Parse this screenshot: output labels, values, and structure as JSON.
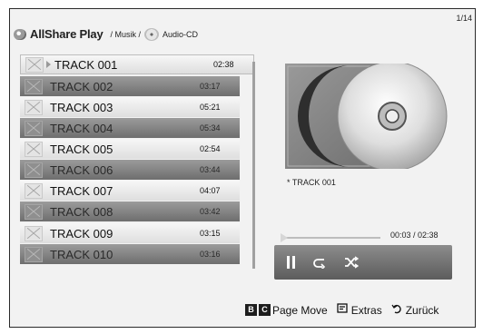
{
  "header": {
    "app_name": "AllShare Play",
    "crumb_music": "/ Musik /",
    "crumb_source": "Audio-CD",
    "page_indicator": "1/14"
  },
  "tracks": [
    {
      "name": "TRACK 001",
      "duration": "02:38"
    },
    {
      "name": "TRACK 002",
      "duration": "03:17"
    },
    {
      "name": "TRACK 003",
      "duration": "05:21"
    },
    {
      "name": "TRACK 004",
      "duration": "05:34"
    },
    {
      "name": "TRACK 005",
      "duration": "02:54"
    },
    {
      "name": "TRACK 006",
      "duration": "03:44"
    },
    {
      "name": "TRACK 007",
      "duration": "04:07"
    },
    {
      "name": "TRACK 008",
      "duration": "03:42"
    },
    {
      "name": "TRACK 009",
      "duration": "03:15"
    },
    {
      "name": "TRACK 010",
      "duration": "03:16"
    }
  ],
  "now_playing": {
    "label": "* TRACK 001",
    "time": "00:03 / 02:38",
    "progress_fraction": 0.02
  },
  "controls": {
    "pause_icon": "pause-icon",
    "repeat_icon": "repeat-icon",
    "shuffle_icon": "shuffle-icon"
  },
  "footer": {
    "key_b": "B",
    "key_c": "C",
    "page_move": "Page Move",
    "extras": "Extras",
    "back": "Zurück"
  }
}
